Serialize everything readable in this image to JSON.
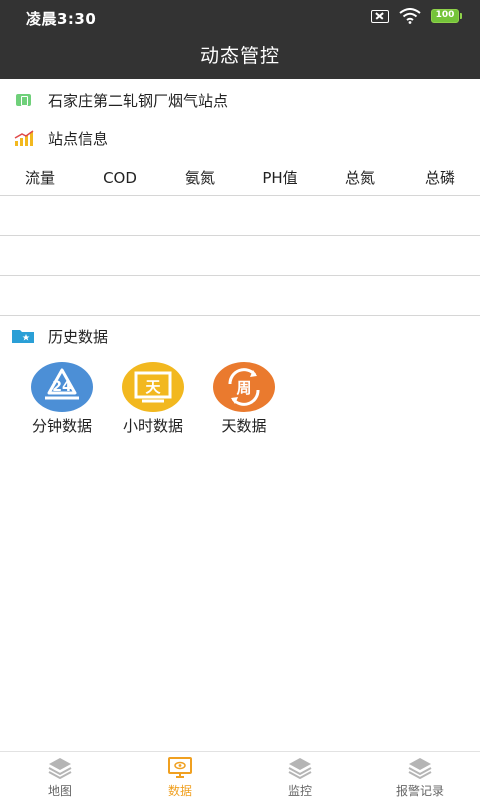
{
  "status_bar": {
    "time": "凌晨3:30",
    "battery": "100"
  },
  "app_bar": {
    "title": "动态管控"
  },
  "station": {
    "name": "石家庄第二轧钢厂烟气站点",
    "icon": "station-icon"
  },
  "station_info": {
    "label": "站点信息",
    "icon": "bar-chart-icon"
  },
  "metrics": {
    "columns": [
      "流量",
      "COD",
      "氨氮",
      "PH值",
      "总氮",
      "总磷"
    ]
  },
  "history": {
    "label": "历史数据",
    "buttons": [
      {
        "label": "分钟数据",
        "glyph": "24",
        "color": "#4c8fd6"
      },
      {
        "label": "小时数据",
        "glyph": "天",
        "color": "#f2b81f"
      },
      {
        "label": "天数据",
        "glyph": "周",
        "color": "#ea7a2e"
      }
    ]
  },
  "bottom_nav": {
    "items": [
      {
        "label": "地图",
        "icon": "layers-icon",
        "active": false
      },
      {
        "label": "数据",
        "icon": "monitor-icon",
        "active": true
      },
      {
        "label": "监控",
        "icon": "layers-icon",
        "active": false
      },
      {
        "label": "报警记录",
        "icon": "layers-icon",
        "active": false
      }
    ],
    "active_color": "#f0a020",
    "inactive_color": "#666666"
  }
}
